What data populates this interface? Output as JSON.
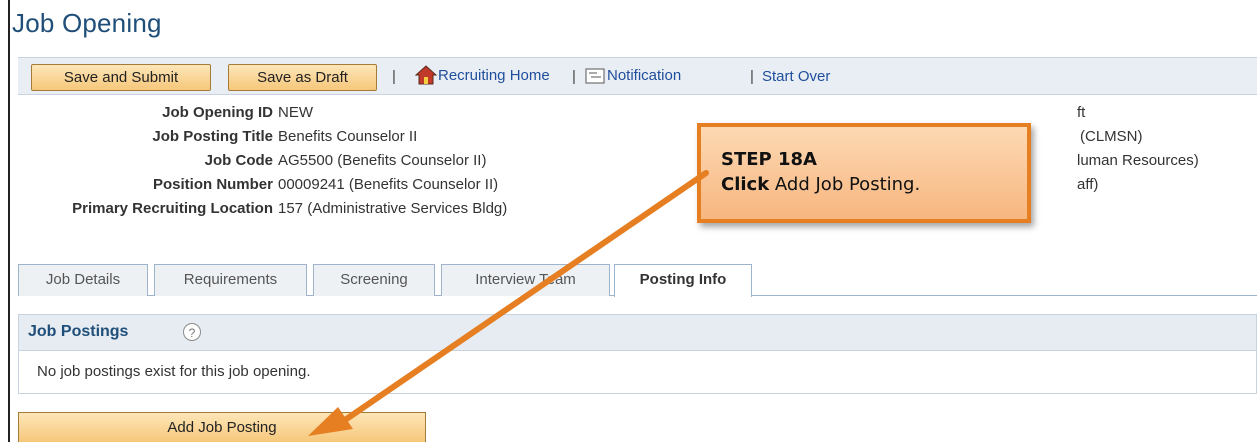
{
  "page": {
    "title": "Job Opening"
  },
  "toolbar": {
    "save_submit": "Save and Submit",
    "save_draft": "Save as Draft",
    "separator": "|",
    "recruiting_home": "Recruiting Home",
    "notification": "Notification",
    "start_over": "Start Over",
    "icons": [
      "house-icon",
      "notification-icon"
    ]
  },
  "fields": {
    "job_opening_id": {
      "label": "Job Opening ID",
      "value": "NEW"
    },
    "job_posting_title": {
      "label": "Job Posting Title",
      "value": "Benefits Counselor II"
    },
    "job_code": {
      "label": "Job Code",
      "value": "AG5500 (Benefits Counselor II)"
    },
    "position_number": {
      "label": "Position Number",
      "value": "00009241 (Benefits Counselor II)"
    },
    "primary_location": {
      "label": "Primary Recruiting Location",
      "value": "157 (Administrative Services Bldg)"
    }
  },
  "right_fragments": [
    "ft",
    "(CLMSN)",
    "luman Resources)",
    "aff)"
  ],
  "tabs": [
    {
      "label": "Job Details"
    },
    {
      "label": "Requirements"
    },
    {
      "label": "Screening"
    },
    {
      "label": "Interview Team"
    },
    {
      "label": "Posting Info",
      "active": true
    }
  ],
  "postings": {
    "title": "Job Postings",
    "help": "?",
    "empty_message": "No job postings exist for this job opening.",
    "add_button": "Add Job Posting"
  },
  "callout": {
    "step": "STEP 18A",
    "action": "Click",
    "instruction": " Add Job Posting."
  },
  "colors": {
    "title_blue": "#1f4e79",
    "button_orange": "#f6c77a",
    "callout_border": "#e67e22",
    "arrow": "#e67e22",
    "toolbar_bg": "#e9eef4"
  }
}
